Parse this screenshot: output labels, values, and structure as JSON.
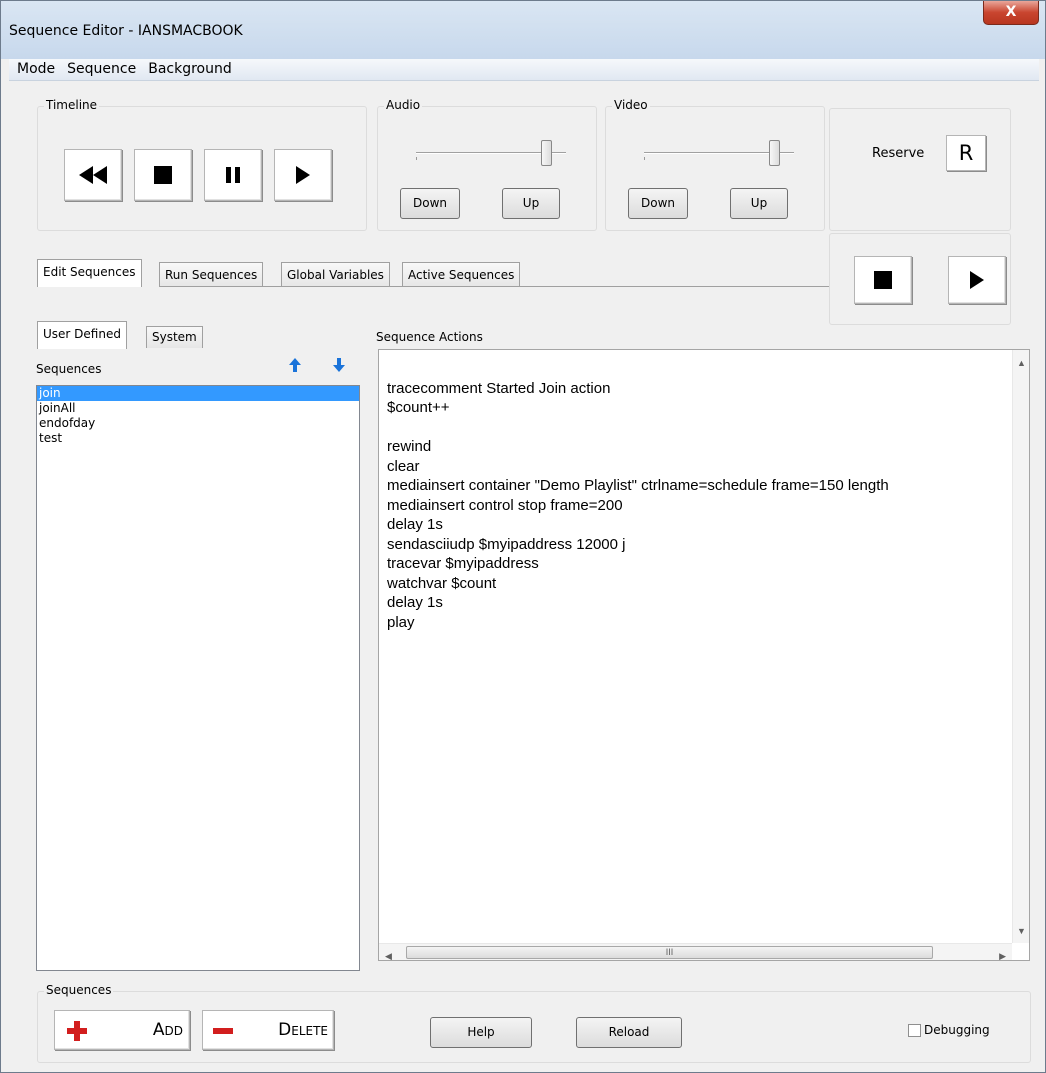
{
  "window": {
    "title": "Sequence Editor - IANSMACBOOK",
    "close_glyph": "X"
  },
  "menu": [
    "Mode",
    "Sequence",
    "Background"
  ],
  "timeline": {
    "label": "Timeline",
    "buttons": [
      "rewind-icon",
      "stop-icon",
      "pause-icon",
      "play-icon"
    ]
  },
  "audio": {
    "label": "Audio",
    "level": 1.0,
    "down": "Down",
    "up": "Up"
  },
  "video": {
    "label": "Video",
    "level": 1.0,
    "down": "Down",
    "up": "Up"
  },
  "reserve": {
    "label": "Reserve",
    "button": "R"
  },
  "transport": [
    "stop-icon",
    "play-icon"
  ],
  "tabs": [
    "Edit Sequences",
    "Run Sequences",
    "Global Variables",
    "Active Sequences"
  ],
  "subtabs": [
    "User Defined",
    "System"
  ],
  "sequences": {
    "label": "Sequences",
    "items": [
      "join",
      "joinAll",
      "endofday",
      "test"
    ],
    "selected": "join"
  },
  "actions": {
    "label": "Sequence Actions",
    "lines": [
      "",
      "tracecomment Started Join action",
      "$count++",
      "",
      "rewind",
      "clear",
      "mediainsert container \"Demo Playlist\" ctrlname=schedule frame=150 length",
      "mediainsert control stop frame=200",
      "delay 1s",
      "sendasciiudp $myipaddress 12000 j",
      "tracevar $myipaddress",
      "watchvar $count",
      "delay 1s",
      "play"
    ],
    "scroll_thumb_glyph": "III"
  },
  "bottom": {
    "label": "Sequences",
    "add": "Add",
    "delete": "Delete",
    "help": "Help",
    "reload": "Reload",
    "debugging": "Debugging",
    "debugging_checked": false
  },
  "colors": {
    "accent_red": "#d21e1e",
    "arrow_blue": "#1a73d9",
    "selection": "#3399ff"
  }
}
